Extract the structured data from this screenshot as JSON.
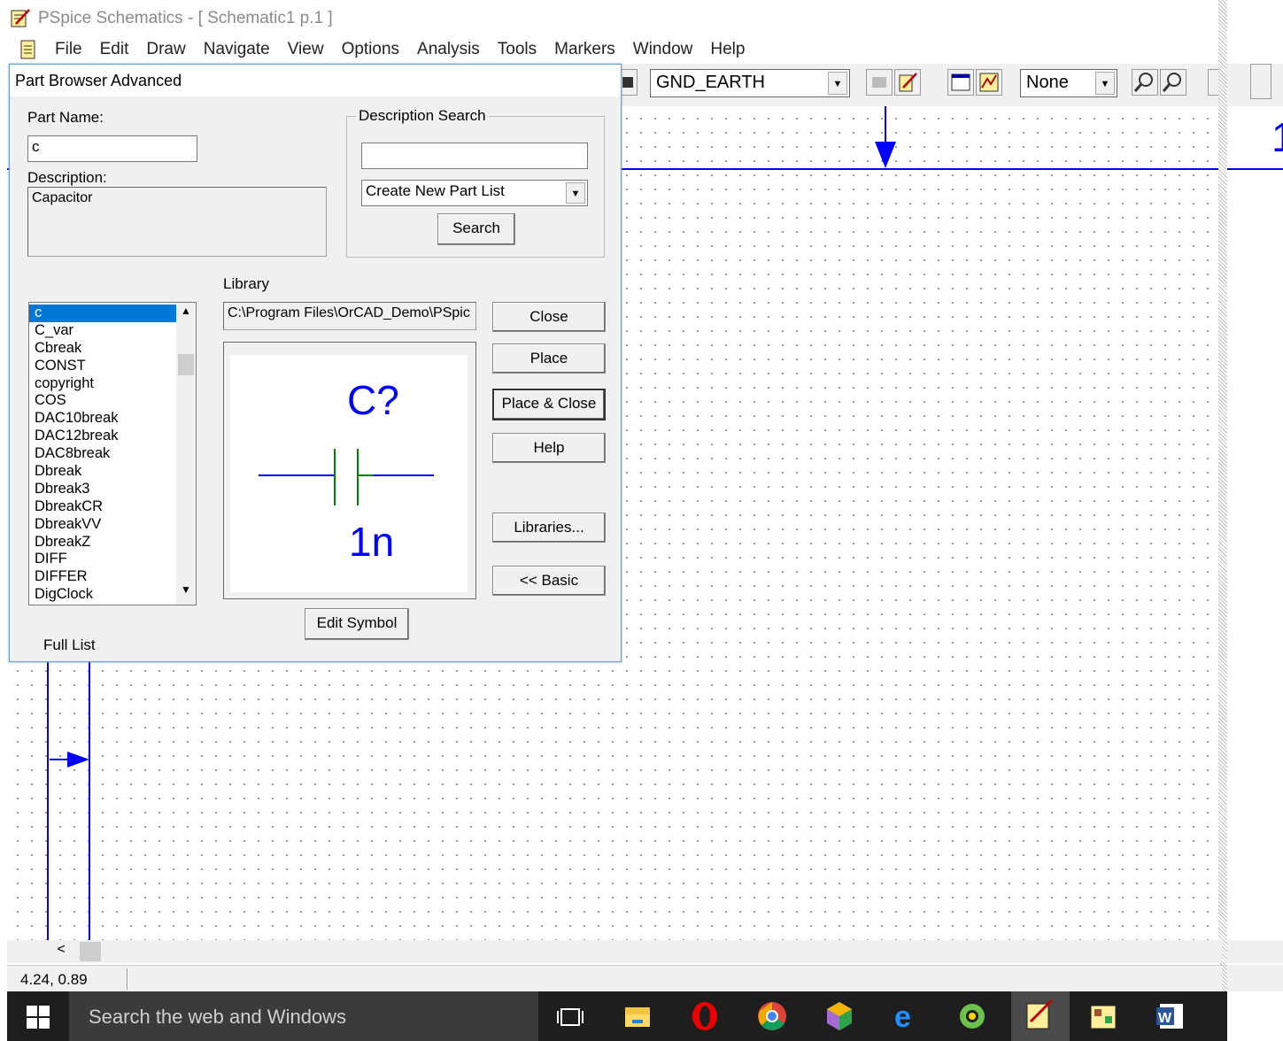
{
  "window": {
    "title": "PSpice Schematics - [ Schematic1  p.1  ]"
  },
  "menu": [
    "File",
    "Edit",
    "Draw",
    "Navigate",
    "View",
    "Options",
    "Analysis",
    "Tools",
    "Markers",
    "Window",
    "Help"
  ],
  "toolbar": {
    "part_combo": "GND_EARTH",
    "display_combo": "None"
  },
  "dialog": {
    "title": "Part Browser Advanced",
    "part_name_label": "Part Name:",
    "part_name_value": "c",
    "description_label": "Description:",
    "description_value": "Capacitor",
    "description_search_label": "Description Search",
    "description_search_value": "",
    "part_list_select": "Create New Part List",
    "search_button": "Search",
    "library_label": "Library",
    "library_path": "C:\\Program Files\\OrCAD_Demo\\PSpic",
    "parts": [
      "c",
      "C_var",
      "Cbreak",
      "CONST",
      "copyright",
      "COS",
      "DAC10break",
      "DAC12break",
      "DAC8break",
      "Dbreak",
      "Dbreak3",
      "DbreakCR",
      "DbreakVV",
      "DbreakZ",
      "DIFF",
      "DIFFER",
      "DigClock"
    ],
    "selected_part": "c",
    "preview": {
      "refdes": "C?",
      "value": "1n"
    },
    "buttons": {
      "close": "Close",
      "place": "Place",
      "place_close": "Place & Close",
      "help": "Help",
      "libraries": "Libraries...",
      "basic": "<< Basic",
      "edit_symbol": "Edit Symbol"
    },
    "full_list_label": "Full List"
  },
  "status": {
    "coords": "4.24,  0.89"
  },
  "taskbar": {
    "search_placeholder": "Search the web and Windows"
  },
  "right_pane_glyph": "1",
  "colors": {
    "wire": "#0000ff",
    "capacitor_body": "#008000",
    "selection": "#0078d7",
    "taskbar": "#1e1e1e"
  }
}
